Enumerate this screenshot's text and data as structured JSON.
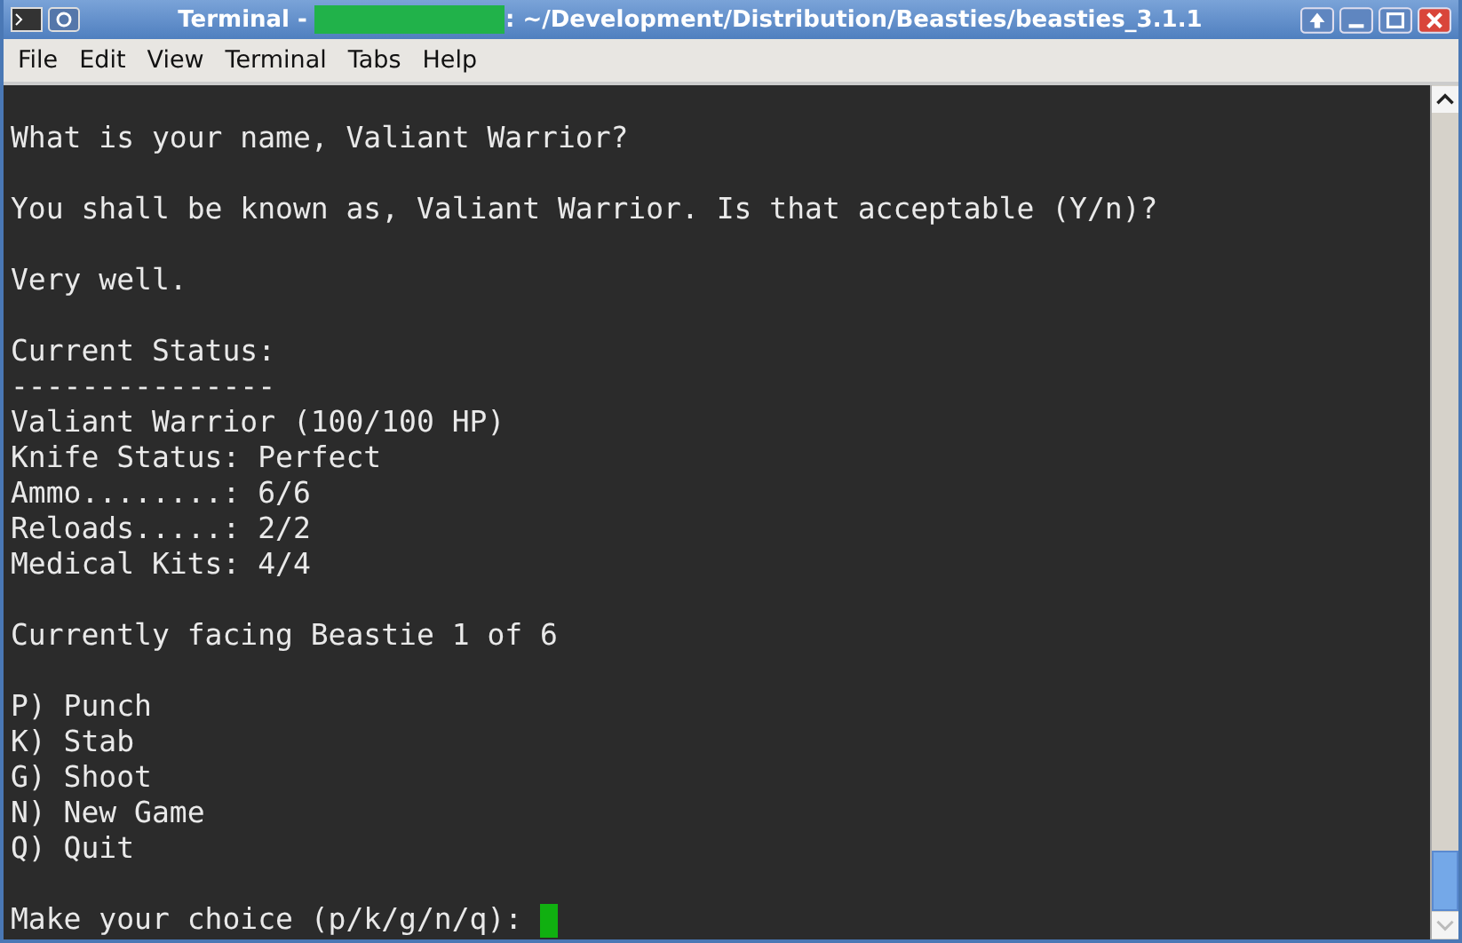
{
  "window": {
    "title_prefix": "Terminal - ",
    "title_path": ": ~/Development/Distribution/Beasties/beasties_3.1.1"
  },
  "menu": [
    "File",
    "Edit",
    "View",
    "Terminal",
    "Tabs",
    "Help"
  ],
  "terminal": {
    "blocks": [
      [
        "What is your name, Valiant Warrior?"
      ],
      [
        "You shall be known as, Valiant Warrior. Is that acceptable (Y/n)?"
      ],
      [
        "Very well."
      ],
      [
        "Current Status:",
        "---------------",
        "Valiant Warrior (100/100 HP)",
        "Knife Status: Perfect",
        "Ammo........: 6/6",
        "Reloads.....: 2/2",
        "Medical Kits: 4/4"
      ],
      [
        "Currently facing Beastie 1 of 6"
      ],
      [
        "P) Punch",
        "K) Stab",
        "G) Shoot",
        "N) New Game",
        "Q) Quit"
      ]
    ],
    "prompt": "Make your choice (p/k/g/n/q):"
  }
}
